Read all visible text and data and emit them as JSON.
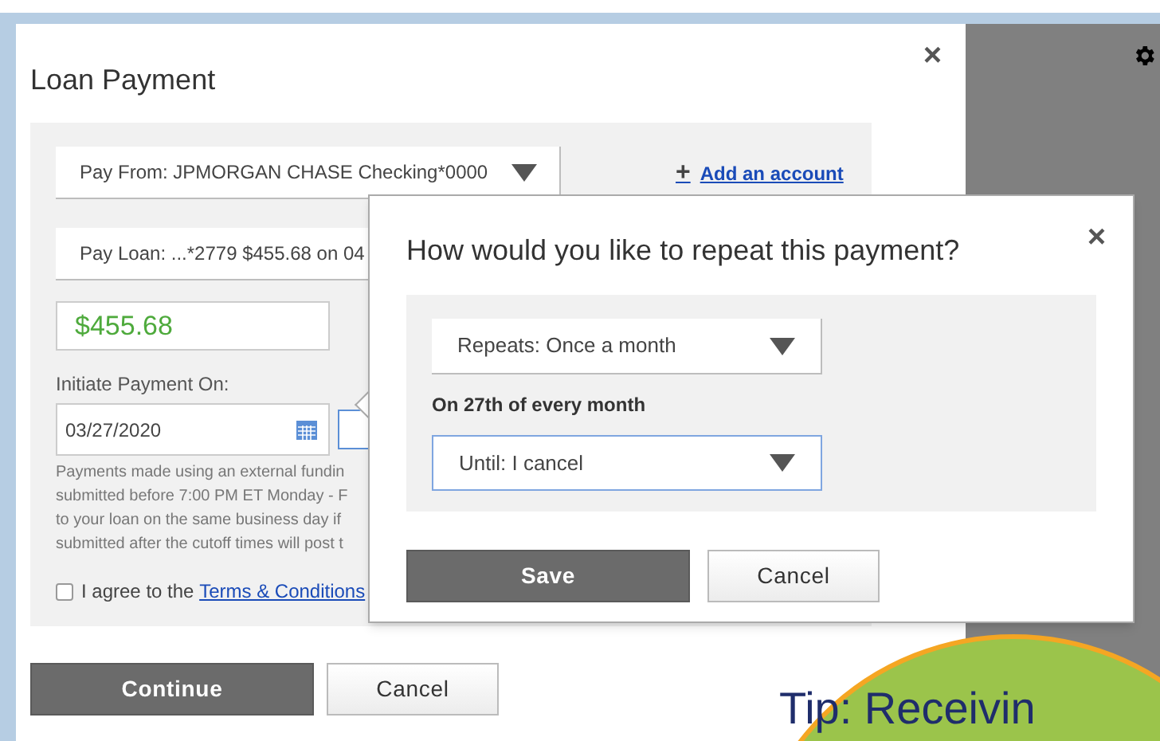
{
  "dialog": {
    "title": "Loan Payment",
    "close": "×",
    "pay_from": {
      "value": "Pay From: JPMORGAN CHASE Checking*0000"
    },
    "add_account": {
      "icon": "+",
      "label": "Add an account"
    },
    "pay_loan": {
      "value": "Pay Loan: ...*2779 $455.68 on 04"
    },
    "amount": {
      "value": "$455.68"
    },
    "date_label": "Initiate Payment On:",
    "date": {
      "value": "03/27/2020"
    },
    "notice_lines": [
      "Payments made using an external fundin",
      "submitted before 7:00 PM ET Monday - F",
      "to your loan on the same business day if",
      "submitted after the cutoff times will post t"
    ],
    "agree": {
      "checked": false,
      "text": "I agree to the ",
      "link": "Terms & Conditions"
    },
    "buttons": [
      {
        "label": "Continue",
        "kind": "primary"
      },
      {
        "label": "Cancel",
        "kind": "secondary"
      }
    ]
  },
  "repeat_popup": {
    "title": "How would you like to repeat this payment?",
    "close": "×",
    "repeats": {
      "value": "Repeats: Once a month",
      "focused": false
    },
    "schedule_note": "On 27th of every month",
    "until": {
      "value": "Until: I cancel",
      "focused": true
    },
    "buttons": [
      {
        "label": "Save",
        "kind": "primary"
      },
      {
        "label": "Cancel",
        "kind": "secondary"
      }
    ]
  },
  "tip": {
    "text": "Tip: Receivin"
  }
}
